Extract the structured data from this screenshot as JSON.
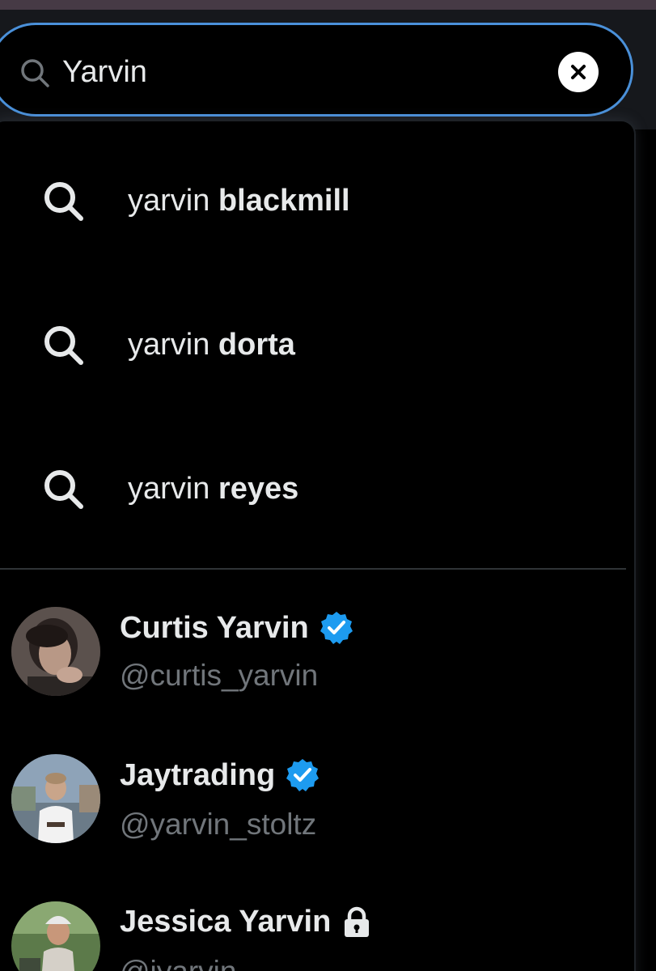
{
  "search": {
    "query": "Yarvin",
    "icon": "search-icon",
    "clear_icon": "close-icon"
  },
  "suggestions": [
    {
      "prefix": "yarvin ",
      "completion": "blackmill",
      "icon": "search-icon"
    },
    {
      "prefix": "yarvin ",
      "completion": "dorta",
      "icon": "search-icon"
    },
    {
      "prefix": "yarvin ",
      "completion": "reyes",
      "icon": "search-icon"
    }
  ],
  "users": [
    {
      "name": "Curtis Yarvin",
      "handle": "@curtis_yarvin",
      "badge": "verified-badge-icon"
    },
    {
      "name": "Jaytrading",
      "handle": "@yarvin_stoltz",
      "badge": "verified-badge-icon"
    },
    {
      "name": "Jessica Yarvin",
      "handle": "@jyarvin",
      "badge": "lock-icon"
    }
  ],
  "colors": {
    "accent": "#4a90d9",
    "verified": "#1d9bf0",
    "text": "#e7e9ea",
    "muted": "#71767b",
    "background": "#000000"
  }
}
